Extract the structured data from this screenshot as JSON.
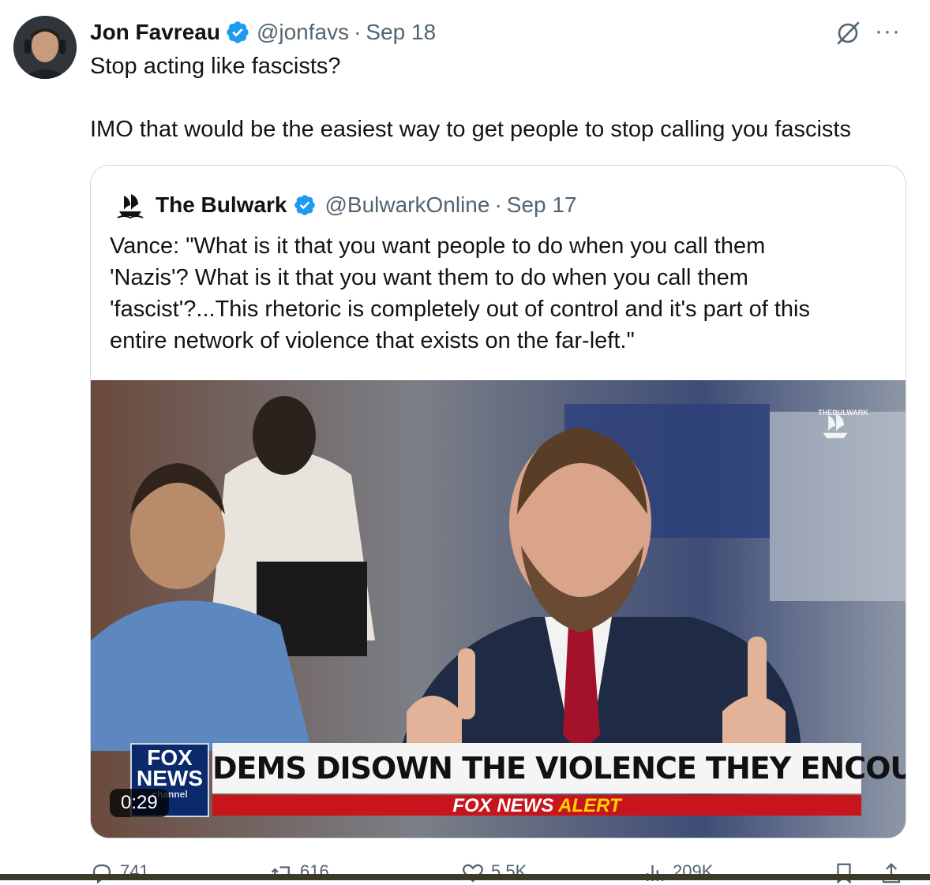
{
  "tweet": {
    "author_name": "Jon Favreau",
    "handle": "@jonfavs",
    "separator": "·",
    "date": "Sep 18",
    "text_line1": "Stop acting like fascists?",
    "text_line2": "IMO that would be the easiest way to get people to stop calling you fascists"
  },
  "quote": {
    "author_name": "The Bulwark",
    "handle": "@BulwarkOnline",
    "separator": "·",
    "date": "Sep 17",
    "lines": [
      "Vance: \"What is it that you want people to do when you call them",
      "'Nazis'? What is it that you want them to do when you call them",
      "'fascist'?...This rhetoric is completely out of control and it's part of this",
      "entire network of violence that exists on the far-left.\""
    ],
    "video": {
      "watermark": "THEBULWARK",
      "network_logo_top": "FOX",
      "network_logo_bottom": "NEWS",
      "network_logo_sub": "channel",
      "headline": "DEMS DISOWN THE VIOLENCE THEY ENCOURAGE",
      "alert_prefix": "FOX NEWS ",
      "alert_word": "ALERT",
      "duration": "0:29"
    }
  },
  "actions": {
    "replies": "741",
    "reposts": "616",
    "likes": "5.5K",
    "views": "209K"
  },
  "colors": {
    "verified": "#1d9bf0",
    "secondary_text": "#536471",
    "border": "#cfd9de",
    "fox_red": "#c8141b",
    "fox_blue": "#0b2a6b"
  },
  "icons": [
    "verified-badge-icon",
    "grok-icon",
    "more-icon",
    "bulwark-ship-icon",
    "reply-icon",
    "repost-icon",
    "like-icon",
    "views-icon",
    "bookmark-icon",
    "share-icon"
  ]
}
